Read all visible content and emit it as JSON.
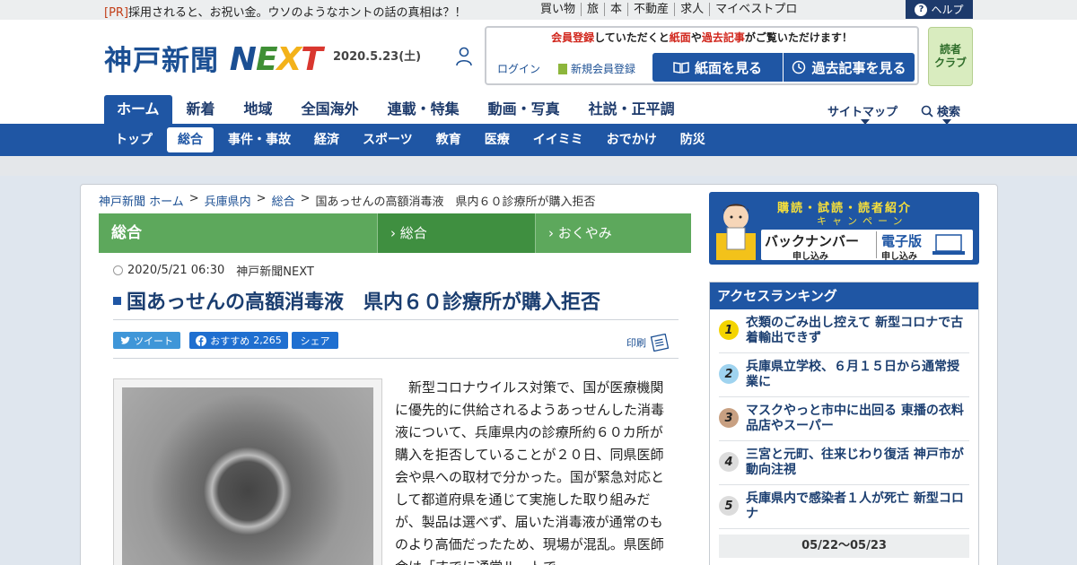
{
  "topbar": {
    "pr_tag": "[PR]",
    "pr_text": "採用されると、お祝い金。ウソのようなホントの話の真相は？！",
    "links": [
      "買い物",
      "旅",
      "本",
      "不動産",
      "求人",
      "マイベストプロ"
    ],
    "help_label": "ヘルプ"
  },
  "header": {
    "logo_main": "神戸新聞",
    "logo_next": [
      "N",
      "E",
      "X",
      "T"
    ],
    "date": "2020.5.23(土)",
    "member_msg_1": "会員登録",
    "member_msg_2": "していただくと",
    "member_msg_3": "紙面",
    "member_msg_4": "や",
    "member_msg_5": "過去記事",
    "member_msg_6": "がご覧いただけます！",
    "login_label": "ログイン",
    "register_label": "新規会員登録",
    "paper_button": "紙面を見る",
    "past_button": "過去記事を見る",
    "reader_club_1": "読者",
    "reader_club_2": "クラブ"
  },
  "main_nav": {
    "items": [
      "ホーム",
      "新着",
      "地域",
      "全国海外",
      "連載・特集",
      "動画・写真",
      "社説・正平調"
    ],
    "sitemap": "サイトマップ",
    "search": "検索"
  },
  "sub_nav": {
    "items": [
      "トップ",
      "総合",
      "事件・事故",
      "経済",
      "スポーツ",
      "教育",
      "医療",
      "イイミミ",
      "おでかけ",
      "防災"
    ]
  },
  "breadcrumb": [
    "神戸新聞 ホーム",
    "兵庫県内",
    "総合",
    "国あっせんの高額消毒液　県内６０診療所が購入拒否"
  ],
  "category_bar": [
    "総合",
    "総合",
    "おくやみ"
  ],
  "article": {
    "datetime": "2020/5/21 06:30",
    "source": "神戸新聞NEXT",
    "title": "国あっせんの高額消毒液　県内６０診療所が購入拒否",
    "tweet": "ツイート",
    "recommend": "おすすめ",
    "recommend_count": "2,265",
    "share": "シェア",
    "print": "印刷",
    "body": "新型コロナウイルス対策で、国が医療機関に優先的に供給されるようあっせんした消毒液について、兵庫県内の診療所約６０カ所が購入を拒否していることが２０日、同県医師会や県への取材で分かった。国が緊急対応として都道府県を通じて実施した取り組みだが、製品は選べず、届いた消毒液が通常のものより高価だったため、現場が混乱。県医師会は「すでに通常ルートで"
  },
  "campaign": {
    "title": "購読・試読・読者紹介",
    "subtitle": "キャンペーン",
    "back_number": "バックナンバー",
    "back_number_sub": "申し込み",
    "digital": "電子版",
    "digital_sub": "申し込み"
  },
  "ranking": {
    "title": "アクセスランキング",
    "items": [
      {
        "rank": "1",
        "text": "衣類のごみ出し控えて 新型コロナで古着輸出できず",
        "color": "#f4d400"
      },
      {
        "rank": "2",
        "text": "兵庫県立学校、６月１５日から通常授業に",
        "color": "#9fd3ef"
      },
      {
        "rank": "3",
        "text": "マスクやっと市中に出回る 東播の衣料品店やスーパー",
        "color": "#c8a082"
      },
      {
        "rank": "4",
        "text": "三宮と元町、往来じわり復活 神戸市が動向注視",
        "color": "#dcdcdc"
      },
      {
        "rank": "5",
        "text": "兵庫県内で感染者１人が死亡 新型コロナ",
        "color": "#dcdcdc"
      }
    ],
    "range": "05/22～05/23"
  }
}
